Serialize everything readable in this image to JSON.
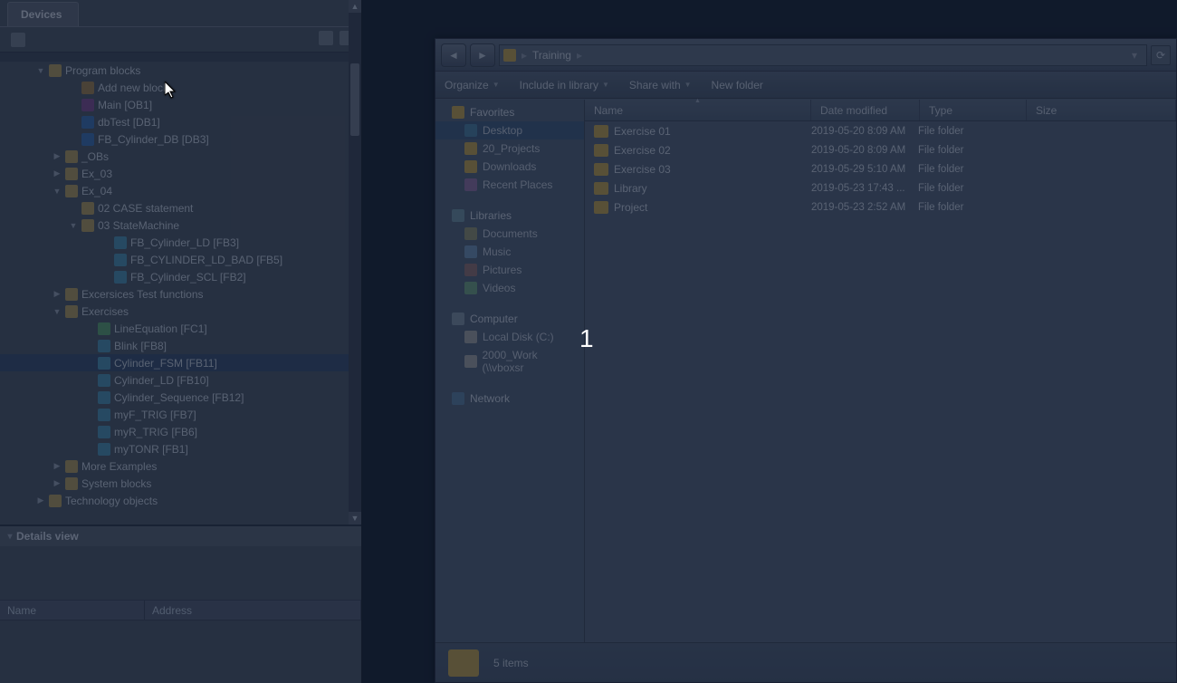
{
  "left": {
    "tab": "Devices",
    "tree": [
      {
        "pad": 40,
        "tw": "▼",
        "ico": "ico-folder",
        "label": "Program blocks"
      },
      {
        "pad": 76,
        "tw": "",
        "ico": "ico-add",
        "label": "Add new block"
      },
      {
        "pad": 76,
        "tw": "",
        "ico": "ico-ob",
        "label": "Main [OB1]"
      },
      {
        "pad": 76,
        "tw": "",
        "ico": "ico-db",
        "label": "dbTest [DB1]"
      },
      {
        "pad": 76,
        "tw": "",
        "ico": "ico-db",
        "label": "FB_Cylinder_DB [DB3]"
      },
      {
        "pad": 58,
        "tw": "▶",
        "ico": "ico-folder",
        "label": "_OBs"
      },
      {
        "pad": 58,
        "tw": "▶",
        "ico": "ico-folder",
        "label": "Ex_03"
      },
      {
        "pad": 58,
        "tw": "▼",
        "ico": "ico-folder",
        "label": "Ex_04"
      },
      {
        "pad": 76,
        "tw": "",
        "ico": "ico-folder",
        "label": "02 CASE statement"
      },
      {
        "pad": 76,
        "tw": "▼",
        "ico": "ico-folder",
        "label": "03 StateMachine"
      },
      {
        "pad": 112,
        "tw": "",
        "ico": "ico-fb",
        "label": "FB_Cylinder_LD [FB3]"
      },
      {
        "pad": 112,
        "tw": "",
        "ico": "ico-fb",
        "label": "FB_CYLINDER_LD_BAD [FB5]"
      },
      {
        "pad": 112,
        "tw": "",
        "ico": "ico-fb",
        "label": "FB_Cylinder_SCL [FB2]"
      },
      {
        "pad": 58,
        "tw": "▶",
        "ico": "ico-folder",
        "label": "Excersices Test functions"
      },
      {
        "pad": 58,
        "tw": "▼",
        "ico": "ico-folder",
        "label": "Exercises"
      },
      {
        "pad": 94,
        "tw": "",
        "ico": "ico-fc",
        "label": "LineEquation [FC1]"
      },
      {
        "pad": 94,
        "tw": "",
        "ico": "ico-fb",
        "label": "Blink [FB8]"
      },
      {
        "pad": 94,
        "tw": "",
        "ico": "ico-fb",
        "label": "Cylinder_FSM [FB11]",
        "sel": true
      },
      {
        "pad": 94,
        "tw": "",
        "ico": "ico-fb",
        "label": "Cylinder_LD [FB10]"
      },
      {
        "pad": 94,
        "tw": "",
        "ico": "ico-fb",
        "label": "Cylinder_Sequence [FB12]"
      },
      {
        "pad": 94,
        "tw": "",
        "ico": "ico-fb",
        "label": "myF_TRIG [FB7]"
      },
      {
        "pad": 94,
        "tw": "",
        "ico": "ico-fb",
        "label": "myR_TRIG [FB6]"
      },
      {
        "pad": 94,
        "tw": "",
        "ico": "ico-fb",
        "label": "myTONR [FB1]"
      },
      {
        "pad": 58,
        "tw": "▶",
        "ico": "ico-folder",
        "label": "More Examples"
      },
      {
        "pad": 58,
        "tw": "▶",
        "ico": "ico-folder",
        "label": "System blocks"
      },
      {
        "pad": 40,
        "tw": "▶",
        "ico": "ico-folder",
        "label": "Technology objects"
      }
    ],
    "details": {
      "title": "Details view",
      "col1": "Name",
      "col2": "Address"
    }
  },
  "explorer": {
    "breadcrumb": [
      "Training"
    ],
    "cmd": {
      "organize": "Organize",
      "include": "Include in library",
      "share": "Share with",
      "newfolder": "New folder"
    },
    "nav": {
      "favorites": "Favorites",
      "desktop": "Desktop",
      "projects": "20_Projects",
      "downloads": "Downloads",
      "recent": "Recent Places",
      "libraries": "Libraries",
      "documents": "Documents",
      "music": "Music",
      "pictures": "Pictures",
      "videos": "Videos",
      "computer": "Computer",
      "localdisk": "Local Disk (C:)",
      "work": "2000_Work (\\\\vboxsr",
      "network": "Network"
    },
    "cols": {
      "name": "Name",
      "date": "Date modified",
      "type": "Type",
      "size": "Size"
    },
    "files": [
      {
        "name": "Exercise 01",
        "date": "2019-05-20 8:09 AM",
        "type": "File folder"
      },
      {
        "name": "Exercise 02",
        "date": "2019-05-20 8:09 AM",
        "type": "File folder"
      },
      {
        "name": "Exercise 03",
        "date": "2019-05-29 5:10 AM",
        "type": "File folder"
      },
      {
        "name": "Library",
        "date": "2019-05-23 17:43 ...",
        "type": "File folder"
      },
      {
        "name": "Project",
        "date": "2019-05-23 2:52 AM",
        "type": "File folder"
      }
    ],
    "status": "5 items"
  },
  "annotation": "1"
}
